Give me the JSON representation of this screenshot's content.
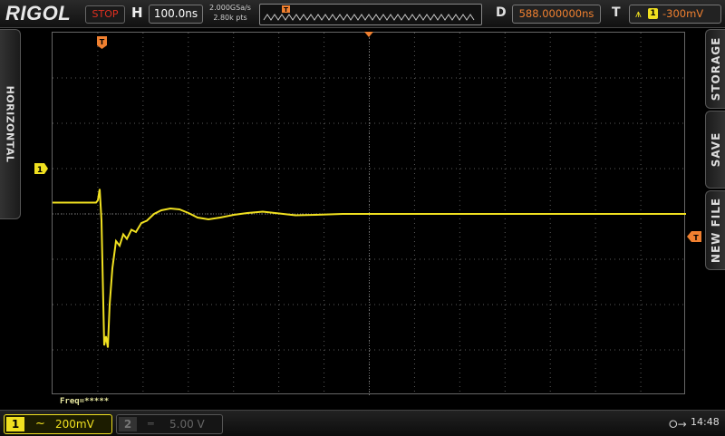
{
  "header": {
    "logo": "RIGOL",
    "run_state": "STOP",
    "timebase_label": "H",
    "timebase": "100.0ns",
    "sample_rate": "2.000GSa/s",
    "memory_points": "2.80k pts",
    "delay_label": "D",
    "delay": "588.000000ns",
    "trigger_label": "T",
    "trigger_source": "1",
    "trigger_level": "-300mV"
  },
  "left_tab": {
    "label": "HORIZONTAL"
  },
  "right_tabs": [
    {
      "label": "STORAGE"
    },
    {
      "label": "SAVE"
    },
    {
      "label": "NEW FILE"
    }
  ],
  "screen": {
    "ch1_marker": "1",
    "trigger_pos_marker": "T",
    "trigger_level_marker": "T",
    "measurement": "Freq=*****"
  },
  "bottom": {
    "ch1": {
      "number": "1",
      "coupling": "~",
      "scale": "200mV"
    },
    "ch2": {
      "number": "2",
      "coupling": "═",
      "scale": "5.00 V"
    },
    "clock": "14:48"
  },
  "colors": {
    "ch1": "#f0e020",
    "trigger": "#f08030",
    "stop": "#e03020",
    "grid": "#5a5a5a"
  },
  "trace": {
    "channel": 1,
    "baseline_div": 0.25,
    "settle_div": 0.0,
    "dip_div": -2.9
  }
}
